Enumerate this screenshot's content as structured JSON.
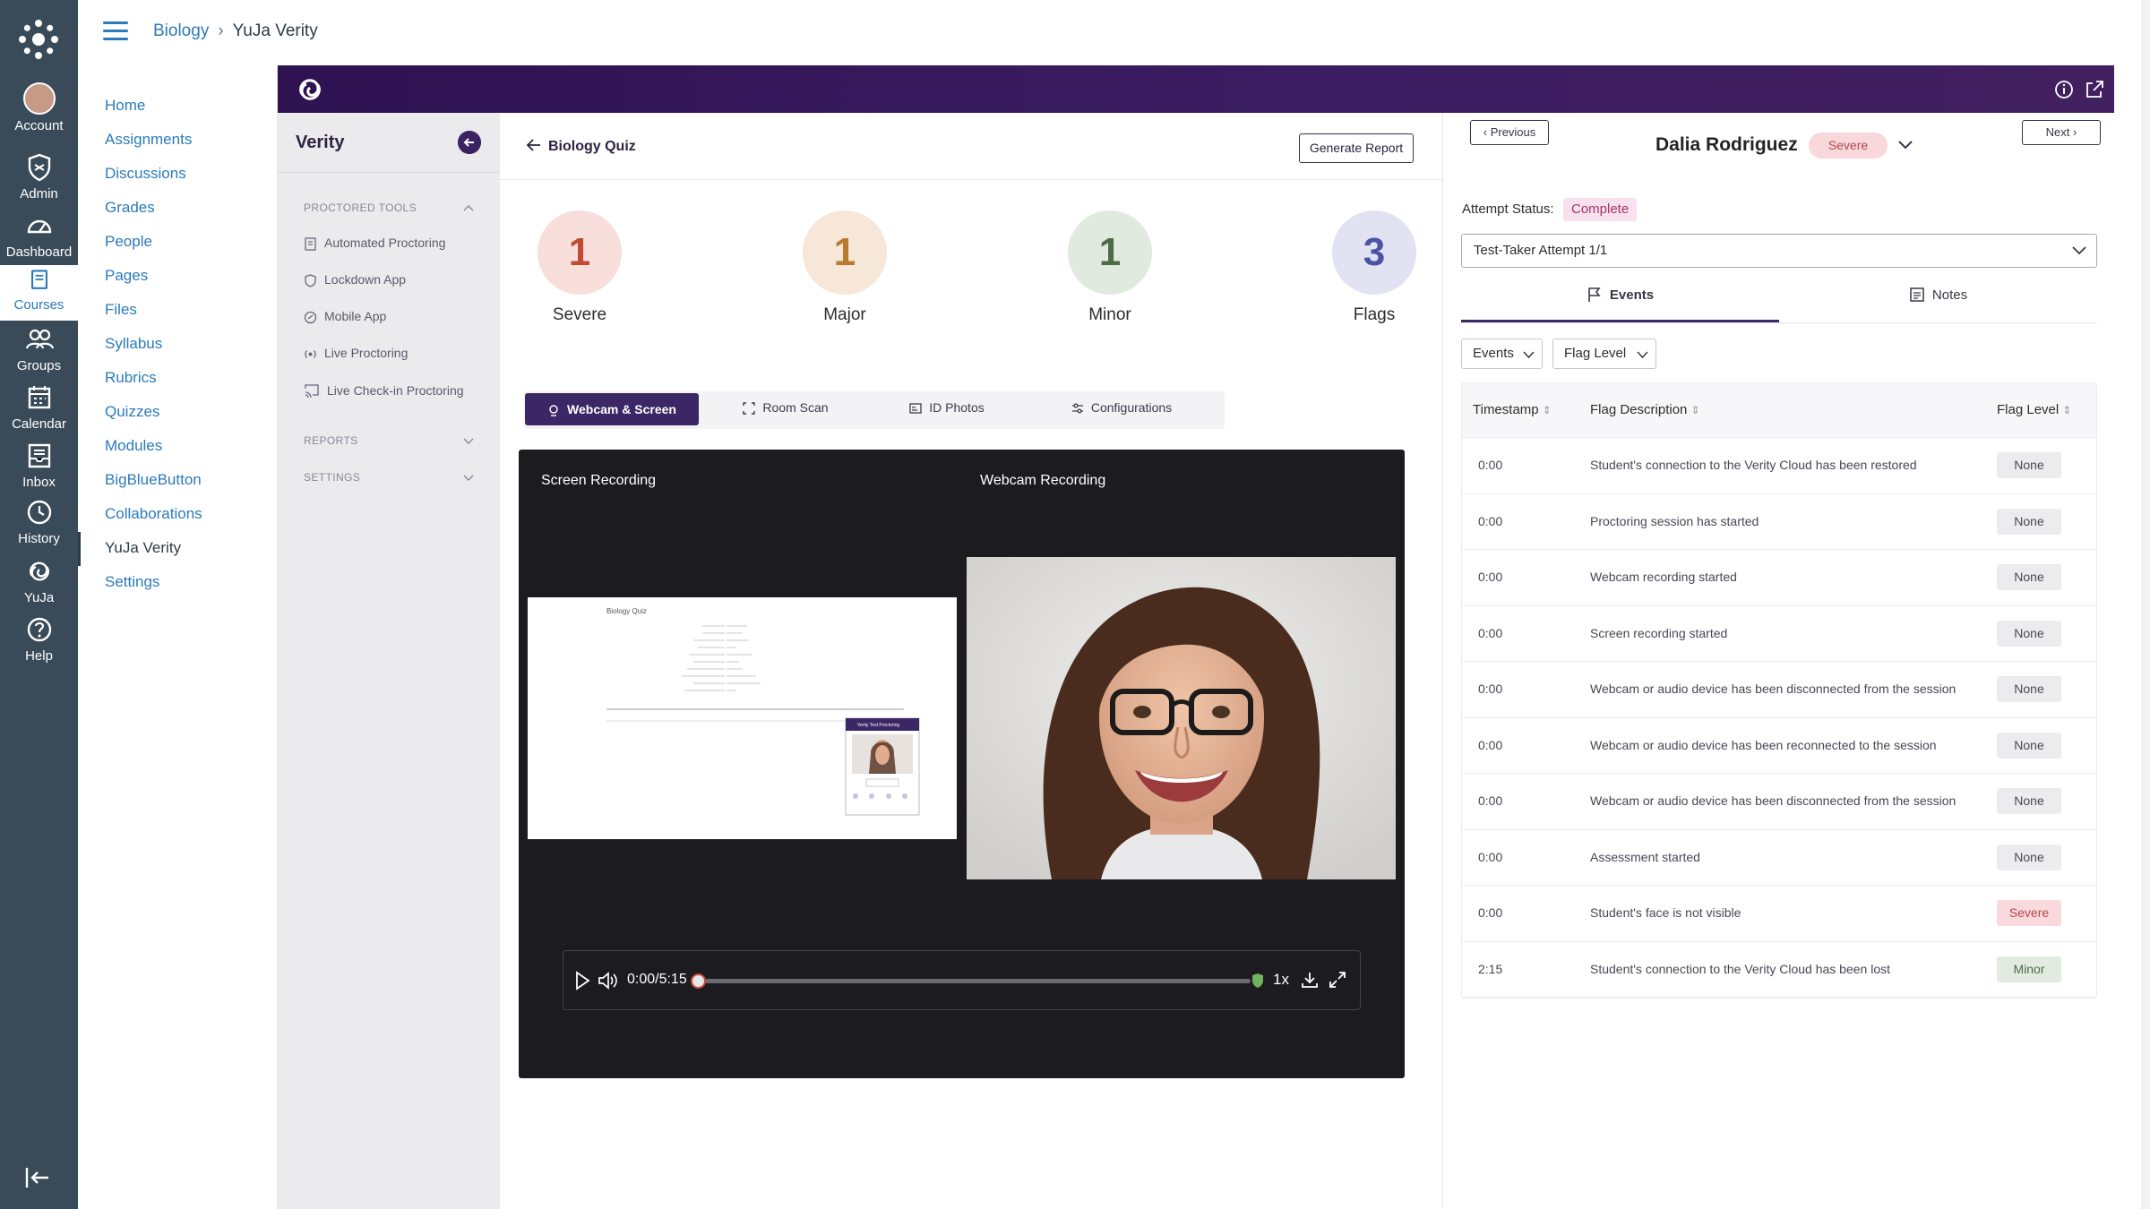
{
  "global_nav": {
    "items": [
      {
        "label": "Account",
        "icon": "account-avatar"
      },
      {
        "label": "Admin",
        "icon": "shield-icon"
      },
      {
        "label": "Dashboard",
        "icon": "dashboard-icon"
      },
      {
        "label": "Courses",
        "icon": "book-icon"
      },
      {
        "label": "Groups",
        "icon": "groups-icon"
      },
      {
        "label": "Calendar",
        "icon": "calendar-icon"
      },
      {
        "label": "Inbox",
        "icon": "inbox-icon"
      },
      {
        "label": "History",
        "icon": "clock-icon"
      },
      {
        "label": "YuJa",
        "icon": "yuja-icon"
      },
      {
        "label": "Help",
        "icon": "help-icon"
      }
    ],
    "active": "Courses",
    "bg_color": "#394b58"
  },
  "breadcrumb": {
    "course": "Biology",
    "current": "YuJa Verity"
  },
  "course_nav": {
    "items": [
      "Home",
      "Assignments",
      "Discussions",
      "Grades",
      "People",
      "Pages",
      "Files",
      "Syllabus",
      "Rubrics",
      "Quizzes",
      "Modules",
      "BigBlueButton",
      "Collaborations",
      "YuJa Verity",
      "Settings"
    ],
    "active": "YuJa Verity"
  },
  "verity_panel": {
    "title": "Verity",
    "section_tools": "PROCTORED TOOLS",
    "tools": [
      "Automated Proctoring",
      "Lockdown App",
      "Mobile App",
      "Live Proctoring",
      "Live Check-in Proctoring"
    ],
    "section_reports": "REPORTS",
    "section_settings": "SETTINGS"
  },
  "main": {
    "quiz_title": "Biology Quiz",
    "generate_report": "Generate Report",
    "stats": [
      {
        "value": "1",
        "label": "Severe",
        "bg": "#f8dfdc",
        "fg": "#c24a32"
      },
      {
        "value": "1",
        "label": "Major",
        "bg": "#f6e7d8",
        "fg": "#b97a2f"
      },
      {
        "value": "1",
        "label": "Minor",
        "bg": "#e1eadf",
        "fg": "#4e6b48"
      },
      {
        "value": "3",
        "label": "Flags",
        "bg": "#e2e3f2",
        "fg": "#4a53a4"
      }
    ],
    "tabs": [
      "Webcam & Screen",
      "Room Scan",
      "ID Photos",
      "Configurations"
    ],
    "active_tab": "Webcam & Screen",
    "player": {
      "screen_label": "Screen Recording",
      "webcam_label": "Webcam Recording",
      "time": "0:00/5:15",
      "speed": "1x",
      "progress": 0.0
    },
    "screen_thumb": {
      "title": "Biology Quiz",
      "popup_title": "Verity Test Proctoring"
    }
  },
  "detail": {
    "prev": "Previous",
    "next": "Next",
    "name": "Dalia Rodriguez",
    "severity": "Severe",
    "attempt_status_label": "Attempt Status:",
    "attempt_status": "Complete",
    "attempt_select": "Test-Taker Attempt 1/1",
    "tabs": [
      "Events",
      "Notes"
    ],
    "active_tab": "Events",
    "filters": [
      "Events",
      "Flag Level"
    ],
    "columns": [
      "Timestamp",
      "Flag Description",
      "Flag Level"
    ],
    "rows": [
      {
        "time": "0:00",
        "desc": "Student's connection to the Verity Cloud has been restored",
        "level": "None"
      },
      {
        "time": "0:00",
        "desc": "Proctoring session has started",
        "level": "None"
      },
      {
        "time": "0:00",
        "desc": "Webcam recording started",
        "level": "None"
      },
      {
        "time": "0:00",
        "desc": "Screen recording started",
        "level": "None"
      },
      {
        "time": "0:00",
        "desc": "Webcam or audio device has been disconnected from the session",
        "level": "None"
      },
      {
        "time": "0:00",
        "desc": "Webcam or audio device has been reconnected to the session",
        "level": "None"
      },
      {
        "time": "0:00",
        "desc": "Webcam or audio device has been disconnected from the session",
        "level": "None"
      },
      {
        "time": "0:00",
        "desc": "Assessment started",
        "level": "None"
      },
      {
        "time": "0:00",
        "desc": "Student's face is not visible",
        "level": "Severe"
      },
      {
        "time": "2:15",
        "desc": "Student's connection to the Verity Cloud has been lost",
        "level": "Minor"
      }
    ]
  },
  "colors": {
    "canvas_link": "#2b7abc",
    "verity_purple": "#3b2766"
  }
}
